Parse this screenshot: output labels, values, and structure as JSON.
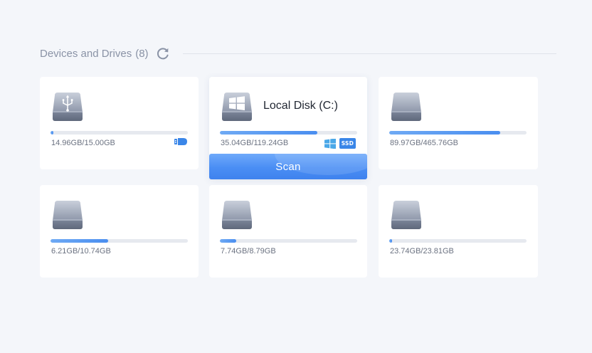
{
  "section": {
    "title": "Devices and Drives",
    "count": "(8)",
    "refresh_icon": "refresh-icon"
  },
  "colors": {
    "background": "#f4f6fa",
    "card": "#ffffff",
    "accent": "#4a8ef0",
    "bar_track": "#e6e9ef"
  },
  "drives": [
    {
      "title": "",
      "icon": "usb-drive-icon",
      "usage": "14.96GB/15.00GB",
      "fill": 0.02,
      "badges": [
        "usb-stick-icon"
      ]
    },
    {
      "title": "Local Disk (C:)",
      "icon": "windows-drive-icon",
      "usage": "35.04GB/119.24GB",
      "fill": 0.71,
      "badges": [
        "windows-icon",
        "ssd-badge"
      ],
      "ssd_label": "SSD",
      "selected": true,
      "action": "Scan"
    },
    {
      "title": "",
      "icon": "hard-drive-icon",
      "usage": "89.97GB/465.76GB",
      "fill": 0.81,
      "badges": []
    },
    {
      "title": "",
      "icon": "hard-drive-icon",
      "usage": "6.21GB/10.74GB",
      "fill": 0.42,
      "badges": []
    },
    {
      "title": "",
      "icon": "hard-drive-icon",
      "usage": "7.74GB/8.79GB",
      "fill": 0.12,
      "badges": []
    },
    {
      "title": "",
      "icon": "hard-drive-icon",
      "usage": "23.74GB/23.81GB",
      "fill": 0.02,
      "badges": []
    }
  ]
}
